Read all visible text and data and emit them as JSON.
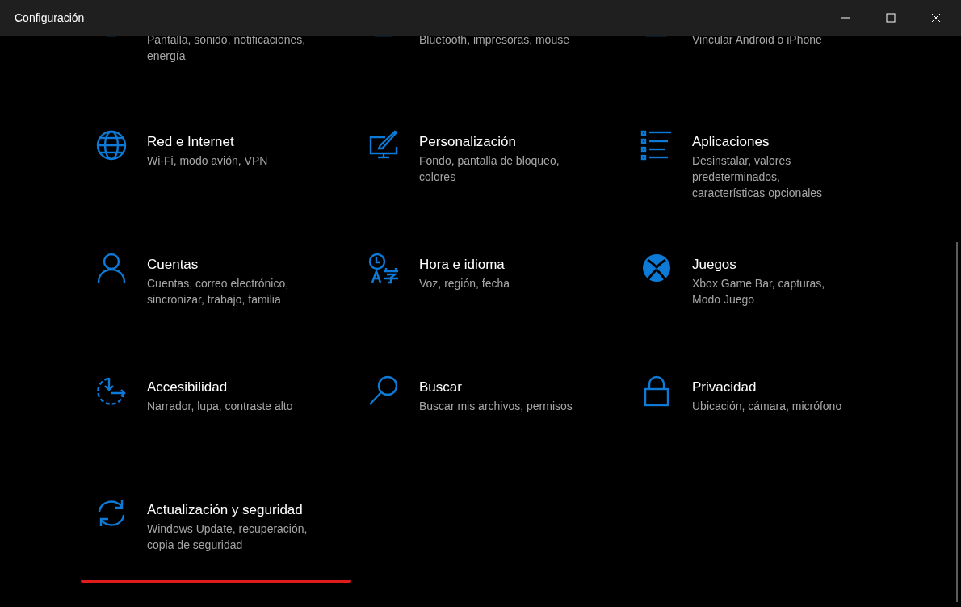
{
  "window": {
    "title": "Configuración"
  },
  "items": [
    {
      "kind": "display",
      "subtitle": "Pantalla, sonido, notificaciones,\nenergía",
      "underlined": false
    },
    {
      "kind": "devices",
      "subtitle": "Bluetooth, impresoras, mouse",
      "underlined": false
    },
    {
      "kind": "phone",
      "subtitle": "Vincular Android o iPhone",
      "underlined": false
    },
    {
      "kind": "globe",
      "title": "Red e Internet",
      "subtitle": "Wi-Fi, modo avión, VPN",
      "underlined": false
    },
    {
      "kind": "personalize",
      "title": "Personalización",
      "subtitle": "Fondo, pantalla de bloqueo,\ncolores",
      "underlined": false
    },
    {
      "kind": "apps",
      "title": "Aplicaciones",
      "subtitle": "Desinstalar, valores\npredeterminados,\ncaracterísticas opcionales",
      "underlined": false
    },
    {
      "kind": "person",
      "title": "Cuentas",
      "subtitle": "Cuentas, correo electrónico,\nsincronizar, trabajo, familia",
      "underlined": false
    },
    {
      "kind": "time-language",
      "title": "Hora e idioma",
      "subtitle": "Voz, región, fecha",
      "underlined": false
    },
    {
      "kind": "xbox",
      "title": "Juegos",
      "subtitle": "Xbox Game Bar, capturas,\nModo Juego",
      "underlined": false
    },
    {
      "kind": "accessibility",
      "title": "Accesibilidad",
      "subtitle": "Narrador, lupa, contraste alto",
      "underlined": false
    },
    {
      "kind": "search",
      "title": "Buscar",
      "subtitle": "Buscar mis archivos, permisos",
      "underlined": false
    },
    {
      "kind": "lock",
      "title": "Privacidad",
      "subtitle": "Ubicación, cámara, micrófono",
      "underlined": false
    },
    {
      "kind": "sync",
      "title": "Actualización y seguridad",
      "subtitle": "Windows Update, recuperación,\ncopia de seguridad",
      "underlined": true
    }
  ]
}
